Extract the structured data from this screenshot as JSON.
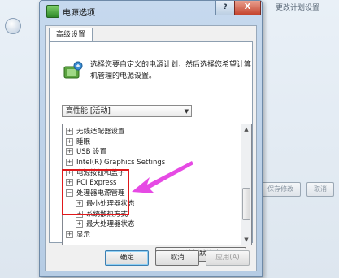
{
  "background_window": {
    "top_right_title": "更改计划设置"
  },
  "background_buttons": [
    "保存修改",
    "取消"
  ],
  "dialog": {
    "title": "电源选项",
    "help_label": "?",
    "close_label": "X",
    "tab_label": "高级设置",
    "intro_text": "选择您要自定义的电源计划，然后选择您希望计算机管理的电源设置。",
    "plan_selected": "高性能 [活动]",
    "tree_items": [
      {
        "label": "无线适配器设置",
        "expander": "+",
        "level": 0
      },
      {
        "label": "睡眠",
        "expander": "+",
        "level": 0
      },
      {
        "label": "USB 设置",
        "expander": "+",
        "level": 0
      },
      {
        "label": "Intel(R) Graphics Settings",
        "expander": "+",
        "level": 0
      },
      {
        "label": "电源按钮和盖子",
        "expander": "+",
        "level": 0
      },
      {
        "label": "PCI Express",
        "expander": "+",
        "level": 0
      },
      {
        "label": "处理器电源管理",
        "expander": "−",
        "level": 0
      },
      {
        "label": "最小处理器状态",
        "expander": "+",
        "level": 1
      },
      {
        "label": "系统散热方式",
        "expander": "+",
        "level": 1
      },
      {
        "label": "最大处理器状态",
        "expander": "+",
        "level": 1
      },
      {
        "label": "显示",
        "expander": "+",
        "level": 0
      }
    ],
    "restore_button": "还原计划默认值(R)",
    "ok_button": "确定",
    "cancel_button": "取消",
    "apply_button": "应用(A)"
  },
  "colors": {
    "highlight": "#e0191c",
    "annotation_arrow": "#e64ae4"
  }
}
